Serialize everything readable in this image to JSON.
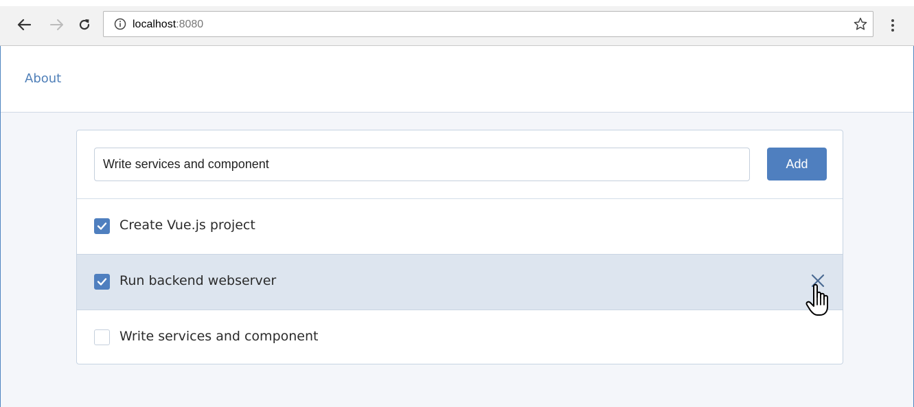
{
  "browser": {
    "url_host": "localhost",
    "url_port": ":8080",
    "icons": {
      "back": "arrow-left-icon",
      "forward": "arrow-right-icon",
      "reload": "reload-icon",
      "info": "info-icon",
      "bookmark": "star-icon",
      "menu": "more-vert-icon"
    }
  },
  "navbar": {
    "about_label": "About"
  },
  "add_form": {
    "input_value": "Write services and component",
    "add_label": "Add"
  },
  "todos": [
    {
      "label": "Create Vue.js project",
      "done": true
    },
    {
      "label": "Run backend webserver",
      "done": true,
      "hovered": true
    },
    {
      "label": "Write services and component",
      "done": false
    }
  ],
  "colors": {
    "accent": "#4f7fbf",
    "link": "#4f7fb8",
    "hover_row": "#dde5ef",
    "page_bg": "#f4f6fa"
  }
}
